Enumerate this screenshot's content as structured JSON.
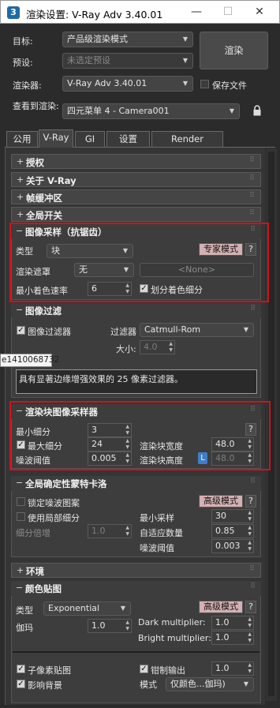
{
  "window": {
    "app_icon": "3",
    "title": "渲染设置: V-Ray Adv 3.40.01"
  },
  "top": {
    "target_label": "目标:",
    "target_value": "产品级渲染模式",
    "preset_label": "预设:",
    "preset_value": "未选定预设",
    "renderer_label": "渲染器:",
    "renderer_value": "V-Ray Adv 3.40.01",
    "save_file_label": "保存文件",
    "view_label": "查看到渲染:",
    "view_value": "四元菜单 4 - Camera001",
    "render_button": "渲染"
  },
  "tabs": [
    "公用",
    "V-Ray",
    "GI",
    "设置",
    "Render Elements"
  ],
  "rollouts": {
    "auth": "授权",
    "about": "关于 V-Ray",
    "fb": "帧缓冲区",
    "global": "全局开关",
    "sampler": "图像采样（抗锯齿）",
    "filter": "图像过滤",
    "bucket": "渲染块图像采样器",
    "dmc": "全局确定性蒙特卡洛",
    "env": "环境",
    "color": "颜色贴图"
  },
  "sampler": {
    "type_label": "类型",
    "type_value": "块",
    "expert": "专家模式",
    "help": "?",
    "mask_label": "渲染遮罩",
    "mask_value": "无",
    "none_value": "<None>",
    "min_rate_label": "最小着色速率",
    "min_rate_value": "6",
    "divide_label": "划分着色细分"
  },
  "filter": {
    "enable_label": "图像过滤器",
    "filter_label": "过滤器",
    "filter_value": "Catmull-Rom",
    "size_label": "大小:",
    "size_value": "4.0",
    "tooltip": "e1410068732",
    "description": "具有显著边缘增强效果的 25 像素过滤器。"
  },
  "bucket": {
    "min_label": "最小细分",
    "min_value": "3",
    "help": "?",
    "max_label": "最大细分",
    "max_value": "24",
    "width_label": "渲染块宽度",
    "width_value": "48.0",
    "noise_label": "噪波阈值",
    "noise_value": "0.005",
    "height_label": "渲染块高度",
    "lock": "L",
    "height_value": "48.0"
  },
  "dmc": {
    "lock_label": "锁定噪波图案",
    "advanced": "高级模式",
    "help": "?",
    "local_label": "使用局部细分",
    "min_samples_label": "最小采样",
    "min_samples_value": "30",
    "mult_label": "细分倍增",
    "mult_value": "1.0",
    "adaptive_label": "自适应数量",
    "adaptive_value": "0.85",
    "noise_label": "噪波阈值",
    "noise_value": "0.003"
  },
  "color": {
    "type_label": "类型",
    "type_value": "Exponential",
    "advanced": "高级模式",
    "help": "?",
    "gamma_label": "伽玛",
    "gamma_value": "1.0",
    "dark_label": "Dark multiplier:",
    "dark_value": "1.0",
    "bright_label": "Bright multiplier:",
    "bright_value": "1.0",
    "subpixel_label": "子像素贴图",
    "clamp_label": "钳制输出",
    "clamp_value": "1.0",
    "affect_bg_label": "影响背景",
    "mode_label": "模式",
    "mode_value": "仅颜色...伽玛)"
  }
}
